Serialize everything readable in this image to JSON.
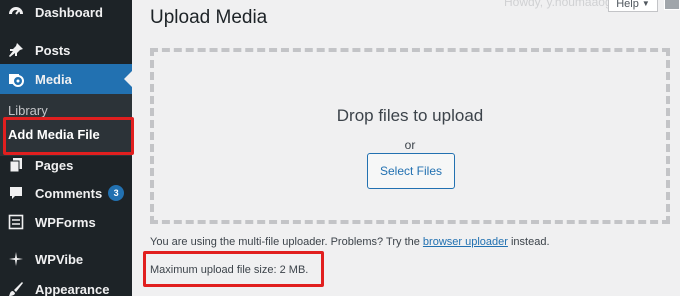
{
  "sidebar": {
    "items": [
      {
        "label": "Dashboard",
        "icon": "dashboard-icon"
      },
      {
        "label": "Posts",
        "icon": "pin-icon"
      },
      {
        "label": "Media",
        "icon": "media-icon",
        "current": true
      },
      {
        "label": "Pages",
        "icon": "pages-icon"
      },
      {
        "label": "Comments",
        "icon": "comment-icon",
        "badge": "3"
      },
      {
        "label": "WPForms",
        "icon": "form-icon"
      },
      {
        "label": "WPVibe",
        "icon": "sparkle-icon"
      },
      {
        "label": "Appearance",
        "icon": "brush-icon"
      }
    ],
    "submenu": {
      "library": "Library",
      "add_new": "Add Media File"
    }
  },
  "header": {
    "howdy": "Howdy, y.houmaaog",
    "help_label": "Help"
  },
  "main": {
    "title": "Upload Media",
    "drop_text": "Drop files to upload",
    "or_text": "or",
    "select_button": "Select Files",
    "note_prefix": "You are using the multi-file uploader. Problems? Try the",
    "note_link": "browser uploader",
    "note_suffix": "instead.",
    "max_size": "Maximum upload file size: 2 MB."
  },
  "colors": {
    "sidebar_bg": "#1d2327",
    "accent": "#2271b1",
    "highlight_box": "#e11f1f",
    "page_bg": "#f0f0f1"
  }
}
